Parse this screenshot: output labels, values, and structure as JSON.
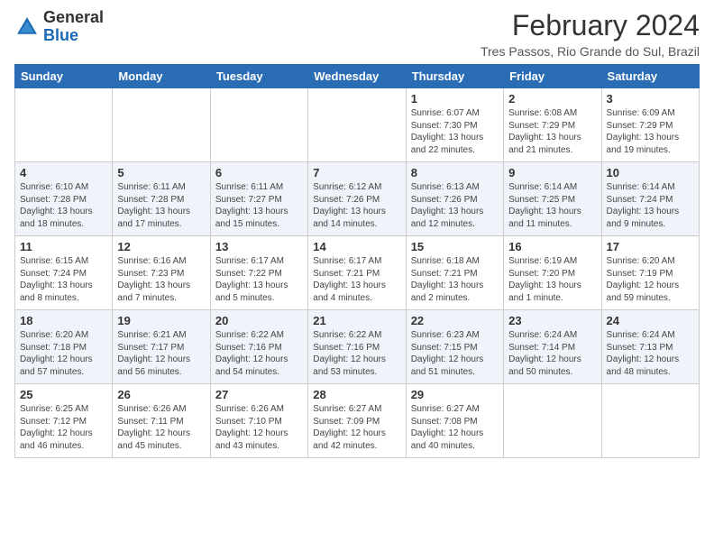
{
  "logo": {
    "general": "General",
    "blue": "Blue"
  },
  "header": {
    "month_year": "February 2024",
    "location": "Tres Passos, Rio Grande do Sul, Brazil"
  },
  "days_of_week": [
    "Sunday",
    "Monday",
    "Tuesday",
    "Wednesday",
    "Thursday",
    "Friday",
    "Saturday"
  ],
  "weeks": [
    [
      {
        "day": "",
        "info": ""
      },
      {
        "day": "",
        "info": ""
      },
      {
        "day": "",
        "info": ""
      },
      {
        "day": "",
        "info": ""
      },
      {
        "day": "1",
        "info": "Sunrise: 6:07 AM\nSunset: 7:30 PM\nDaylight: 13 hours and 22 minutes."
      },
      {
        "day": "2",
        "info": "Sunrise: 6:08 AM\nSunset: 7:29 PM\nDaylight: 13 hours and 21 minutes."
      },
      {
        "day": "3",
        "info": "Sunrise: 6:09 AM\nSunset: 7:29 PM\nDaylight: 13 hours and 19 minutes."
      }
    ],
    [
      {
        "day": "4",
        "info": "Sunrise: 6:10 AM\nSunset: 7:28 PM\nDaylight: 13 hours and 18 minutes."
      },
      {
        "day": "5",
        "info": "Sunrise: 6:11 AM\nSunset: 7:28 PM\nDaylight: 13 hours and 17 minutes."
      },
      {
        "day": "6",
        "info": "Sunrise: 6:11 AM\nSunset: 7:27 PM\nDaylight: 13 hours and 15 minutes."
      },
      {
        "day": "7",
        "info": "Sunrise: 6:12 AM\nSunset: 7:26 PM\nDaylight: 13 hours and 14 minutes."
      },
      {
        "day": "8",
        "info": "Sunrise: 6:13 AM\nSunset: 7:26 PM\nDaylight: 13 hours and 12 minutes."
      },
      {
        "day": "9",
        "info": "Sunrise: 6:14 AM\nSunset: 7:25 PM\nDaylight: 13 hours and 11 minutes."
      },
      {
        "day": "10",
        "info": "Sunrise: 6:14 AM\nSunset: 7:24 PM\nDaylight: 13 hours and 9 minutes."
      }
    ],
    [
      {
        "day": "11",
        "info": "Sunrise: 6:15 AM\nSunset: 7:24 PM\nDaylight: 13 hours and 8 minutes."
      },
      {
        "day": "12",
        "info": "Sunrise: 6:16 AM\nSunset: 7:23 PM\nDaylight: 13 hours and 7 minutes."
      },
      {
        "day": "13",
        "info": "Sunrise: 6:17 AM\nSunset: 7:22 PM\nDaylight: 13 hours and 5 minutes."
      },
      {
        "day": "14",
        "info": "Sunrise: 6:17 AM\nSunset: 7:21 PM\nDaylight: 13 hours and 4 minutes."
      },
      {
        "day": "15",
        "info": "Sunrise: 6:18 AM\nSunset: 7:21 PM\nDaylight: 13 hours and 2 minutes."
      },
      {
        "day": "16",
        "info": "Sunrise: 6:19 AM\nSunset: 7:20 PM\nDaylight: 13 hours and 1 minute."
      },
      {
        "day": "17",
        "info": "Sunrise: 6:20 AM\nSunset: 7:19 PM\nDaylight: 12 hours and 59 minutes."
      }
    ],
    [
      {
        "day": "18",
        "info": "Sunrise: 6:20 AM\nSunset: 7:18 PM\nDaylight: 12 hours and 57 minutes."
      },
      {
        "day": "19",
        "info": "Sunrise: 6:21 AM\nSunset: 7:17 PM\nDaylight: 12 hours and 56 minutes."
      },
      {
        "day": "20",
        "info": "Sunrise: 6:22 AM\nSunset: 7:16 PM\nDaylight: 12 hours and 54 minutes."
      },
      {
        "day": "21",
        "info": "Sunrise: 6:22 AM\nSunset: 7:16 PM\nDaylight: 12 hours and 53 minutes."
      },
      {
        "day": "22",
        "info": "Sunrise: 6:23 AM\nSunset: 7:15 PM\nDaylight: 12 hours and 51 minutes."
      },
      {
        "day": "23",
        "info": "Sunrise: 6:24 AM\nSunset: 7:14 PM\nDaylight: 12 hours and 50 minutes."
      },
      {
        "day": "24",
        "info": "Sunrise: 6:24 AM\nSunset: 7:13 PM\nDaylight: 12 hours and 48 minutes."
      }
    ],
    [
      {
        "day": "25",
        "info": "Sunrise: 6:25 AM\nSunset: 7:12 PM\nDaylight: 12 hours and 46 minutes."
      },
      {
        "day": "26",
        "info": "Sunrise: 6:26 AM\nSunset: 7:11 PM\nDaylight: 12 hours and 45 minutes."
      },
      {
        "day": "27",
        "info": "Sunrise: 6:26 AM\nSunset: 7:10 PM\nDaylight: 12 hours and 43 minutes."
      },
      {
        "day": "28",
        "info": "Sunrise: 6:27 AM\nSunset: 7:09 PM\nDaylight: 12 hours and 42 minutes."
      },
      {
        "day": "29",
        "info": "Sunrise: 6:27 AM\nSunset: 7:08 PM\nDaylight: 12 hours and 40 minutes."
      },
      {
        "day": "",
        "info": ""
      },
      {
        "day": "",
        "info": ""
      }
    ]
  ]
}
